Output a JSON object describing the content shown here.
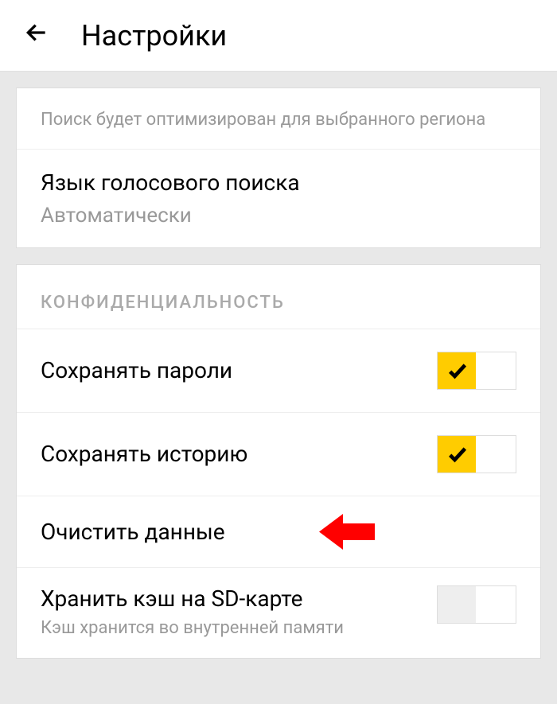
{
  "header": {
    "title": "Настройки"
  },
  "search_card": {
    "hint": "Поиск будет оптимизирован для выбранного региона",
    "voice_search": {
      "title": "Язык голосового поиска",
      "value": "Автоматически"
    }
  },
  "privacy": {
    "section_title": "КОНФИДЕНЦИАЛЬНОСТЬ",
    "save_passwords": {
      "label": "Сохранять пароли",
      "enabled": true
    },
    "save_history": {
      "label": "Сохранять историю",
      "enabled": true
    },
    "clear_data": {
      "label": "Очистить данные"
    },
    "sd_cache": {
      "label": "Хранить кэш на SD-карте",
      "sublabel": "Кэш хранится во внутренней памяти",
      "enabled": false
    }
  },
  "colors": {
    "accent": "#ffcc00",
    "annotation_arrow": "#ff0000"
  }
}
